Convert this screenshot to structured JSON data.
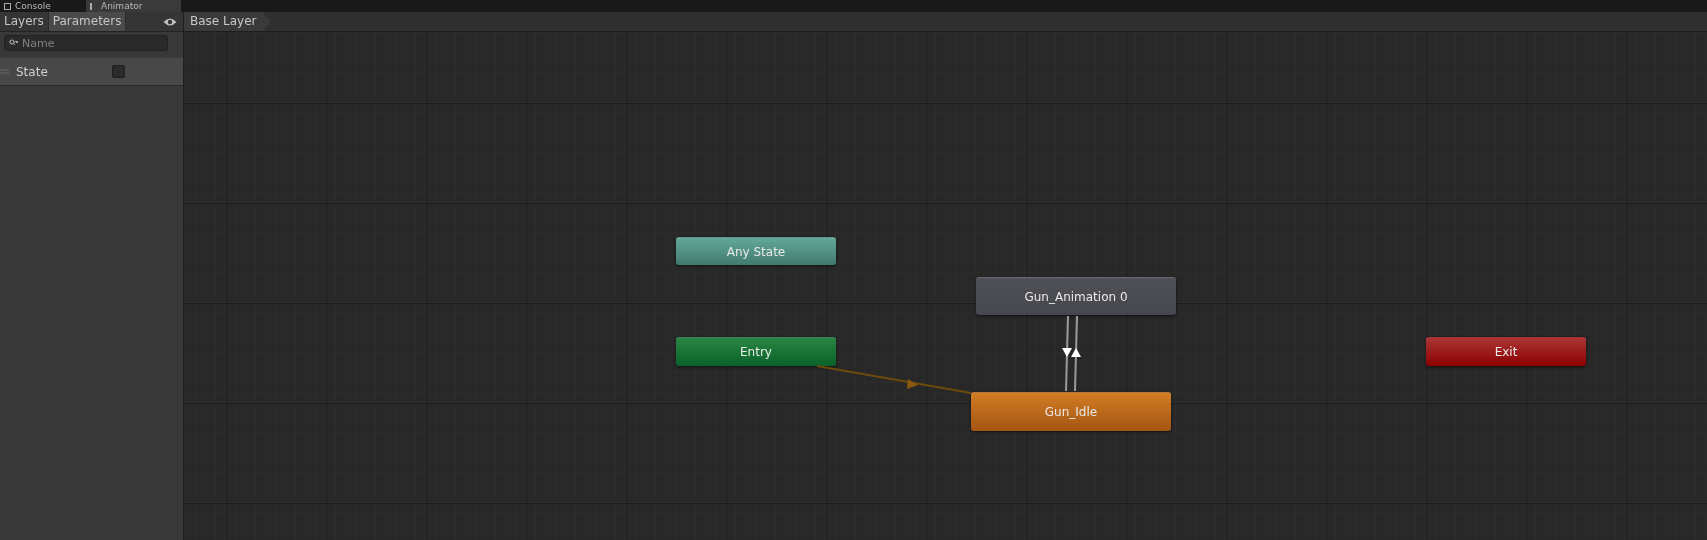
{
  "window_tabs": [
    {
      "label": "Console",
      "selected": false
    },
    {
      "label": "Animator",
      "selected": true
    }
  ],
  "panel_tabs": [
    {
      "label": "Layers",
      "selected": false
    },
    {
      "label": "Parameters",
      "selected": true
    }
  ],
  "search": {
    "placeholder": "Name"
  },
  "parameters": [
    {
      "name": "State",
      "kind": "bool",
      "checked": false
    }
  ],
  "breadcrumb": [
    "Base Layer"
  ],
  "states": [
    {
      "label": "Any State",
      "kind": "any"
    },
    {
      "label": "Gun_Animation 0",
      "kind": "state"
    },
    {
      "label": "Entry",
      "kind": "entry"
    },
    {
      "label": "Gun_Idle",
      "kind": "default"
    },
    {
      "label": "Exit",
      "kind": "exit"
    }
  ]
}
